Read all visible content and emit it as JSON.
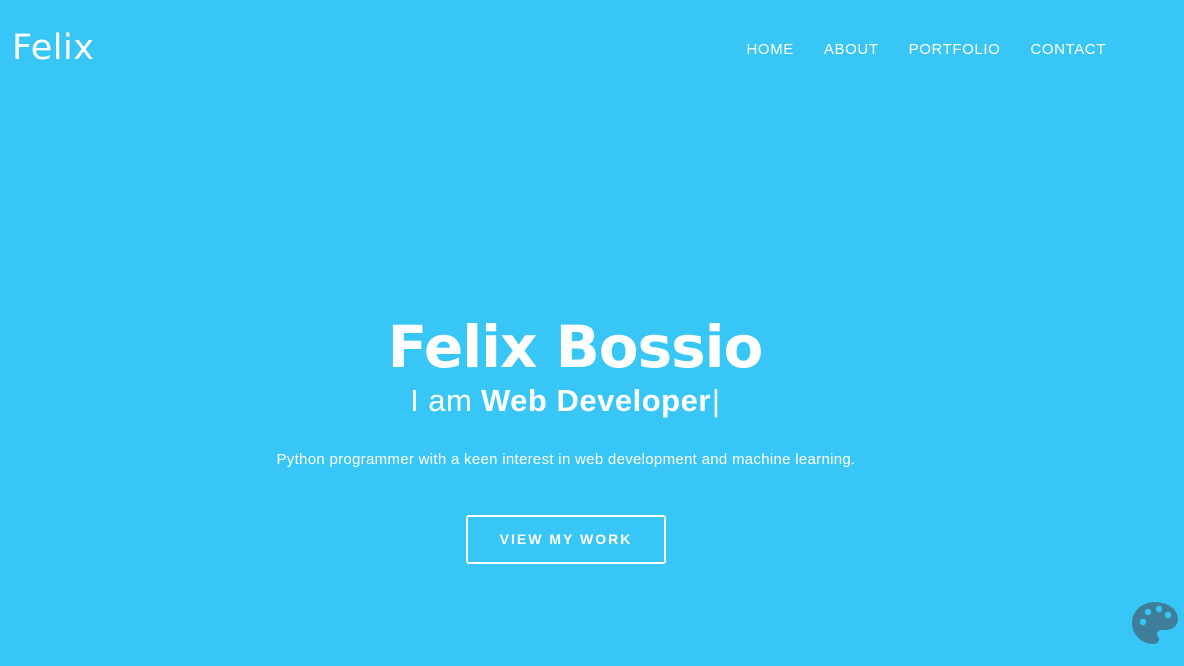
{
  "nav": {
    "brand": "Felix",
    "links": [
      "HOME",
      "ABOUT",
      "PORTFOLIO",
      "CONTACT"
    ]
  },
  "hero": {
    "title": "Felix Bossio",
    "subtitle_prefix": "I am",
    "subtitle_role": "Web Developer",
    "cursor": "|",
    "description": "Python programmer with a keen interest in web development and machine learning.",
    "cta_label": "VIEW MY WORK"
  },
  "widgets": {
    "theme_switcher_icon": "palette-icon"
  },
  "colors": {
    "background": "#38c6f7",
    "text": "#ffffff",
    "palette_icon": "#3f7e9a"
  }
}
